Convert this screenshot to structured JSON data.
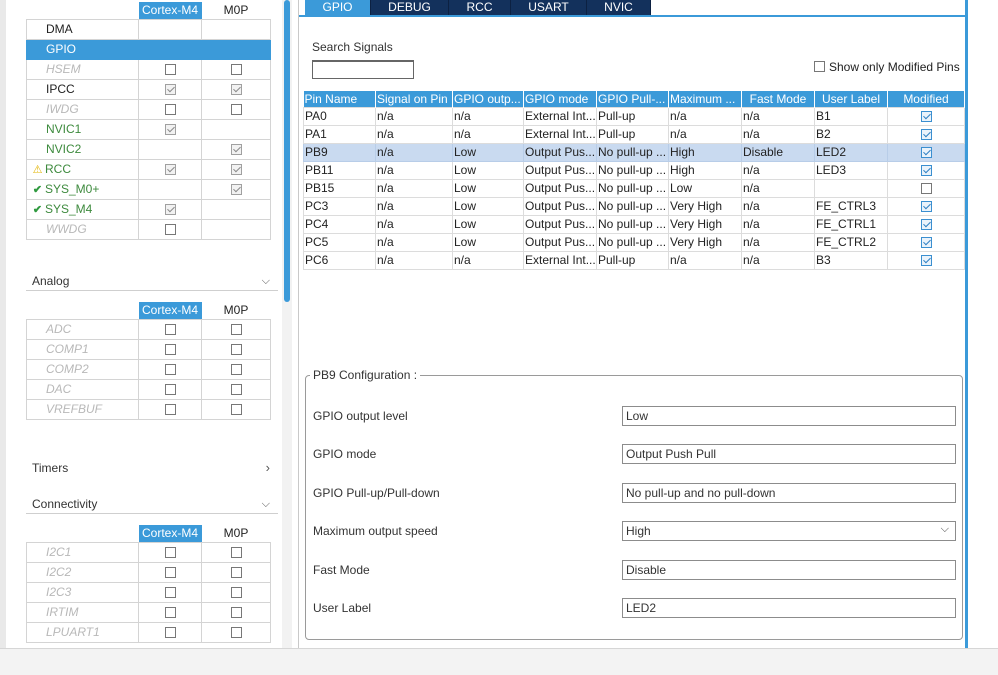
{
  "left": {
    "top_header": {
      "col1": "Cortex-M4",
      "col2": "M0P"
    },
    "top_items": [
      {
        "name": "DMA",
        "status": "none",
        "style": "normal",
        "m4": "",
        "m0p": ""
      },
      {
        "name": "GPIO",
        "status": "none",
        "style": "selected",
        "m4": "",
        "m0p": ""
      },
      {
        "name": "HSEM",
        "status": "none",
        "style": "disabled",
        "m4": "box",
        "m0p": "box"
      },
      {
        "name": "IPCC",
        "status": "none",
        "style": "normal",
        "m4": "checked",
        "m0p": "checked"
      },
      {
        "name": "IWDG",
        "status": "none",
        "style": "disabled",
        "m4": "box",
        "m0p": "box"
      },
      {
        "name": "NVIC1",
        "status": "none",
        "style": "ok",
        "m4": "checked",
        "m0p": ""
      },
      {
        "name": "NVIC2",
        "status": "none",
        "style": "ok",
        "m4": "",
        "m0p": "checked"
      },
      {
        "name": "RCC",
        "status": "warn",
        "style": "ok",
        "m4": "checked",
        "m0p": "checked"
      },
      {
        "name": "SYS_M0+",
        "status": "check",
        "style": "ok",
        "m4": "",
        "m0p": "checked"
      },
      {
        "name": "SYS_M4",
        "status": "check",
        "style": "ok",
        "m4": "checked",
        "m0p": ""
      },
      {
        "name": "WWDG",
        "status": "none",
        "style": "disabled",
        "m4": "box",
        "m0p": ""
      }
    ],
    "analog": {
      "title": "Analog",
      "header": {
        "col1": "Cortex-M4",
        "col2": "M0P"
      },
      "items": [
        {
          "name": "ADC",
          "m4": "box",
          "m0p": "box"
        },
        {
          "name": "COMP1",
          "m4": "box",
          "m0p": "box"
        },
        {
          "name": "COMP2",
          "m4": "box",
          "m0p": "box"
        },
        {
          "name": "DAC",
          "m4": "box",
          "m0p": "box"
        },
        {
          "name": "VREFBUF",
          "m4": "box",
          "m0p": "box"
        }
      ]
    },
    "timers": {
      "title": "Timers"
    },
    "connectivity": {
      "title": "Connectivity",
      "header": {
        "col1": "Cortex-M4",
        "col2": "M0P"
      },
      "items": [
        {
          "name": "I2C1",
          "m4": "box",
          "m0p": "box"
        },
        {
          "name": "I2C2",
          "m4": "box",
          "m0p": "box"
        },
        {
          "name": "I2C3",
          "m4": "box",
          "m0p": "box"
        },
        {
          "name": "IRTIM",
          "m4": "box",
          "m0p": "box"
        },
        {
          "name": "LPUART1",
          "m4": "box",
          "m0p": "box"
        }
      ]
    }
  },
  "tabs": [
    "GPIO",
    "DEBUG",
    "RCC",
    "USART",
    "NVIC"
  ],
  "active_tab": "GPIO",
  "search": {
    "label": "Search Signals",
    "value": ""
  },
  "show_modified_label": "Show only Modified Pins",
  "gpio_table": {
    "columns": [
      "Pin Name",
      "Signal on Pin",
      "GPIO outp...",
      "GPIO mode",
      "GPIO Pull-...",
      "Maximum ...",
      "Fast Mode",
      "User Label",
      "Modified"
    ],
    "rows": [
      {
        "pin": "PA0",
        "signal": "n/a",
        "output": "n/a",
        "mode": "External Int...",
        "pull": "Pull-up",
        "speed": "n/a",
        "fast": "n/a",
        "label": "B1",
        "modified": true
      },
      {
        "pin": "PA1",
        "signal": "n/a",
        "output": "n/a",
        "mode": "External Int...",
        "pull": "Pull-up",
        "speed": "n/a",
        "fast": "n/a",
        "label": "B2",
        "modified": true
      },
      {
        "pin": "PB9",
        "signal": "n/a",
        "output": "Low",
        "mode": "Output Pus...",
        "pull": "No pull-up ...",
        "speed": "High",
        "fast": "Disable",
        "label": "LED2",
        "modified": true,
        "selected": true
      },
      {
        "pin": "PB11",
        "signal": "n/a",
        "output": "Low",
        "mode": "Output Pus...",
        "pull": "No pull-up ...",
        "speed": "High",
        "fast": "n/a",
        "label": "LED3",
        "modified": true
      },
      {
        "pin": "PB15",
        "signal": "n/a",
        "output": "Low",
        "mode": "Output Pus...",
        "pull": "No pull-up ...",
        "speed": "Low",
        "fast": "n/a",
        "label": "",
        "modified": false
      },
      {
        "pin": "PC3",
        "signal": "n/a",
        "output": "Low",
        "mode": "Output Pus...",
        "pull": "No pull-up ...",
        "speed": "Very High",
        "fast": "n/a",
        "label": "FE_CTRL3",
        "modified": true
      },
      {
        "pin": "PC4",
        "signal": "n/a",
        "output": "Low",
        "mode": "Output Pus...",
        "pull": "No pull-up ...",
        "speed": "Very High",
        "fast": "n/a",
        "label": "FE_CTRL1",
        "modified": true
      },
      {
        "pin": "PC5",
        "signal": "n/a",
        "output": "Low",
        "mode": "Output Pus...",
        "pull": "No pull-up ...",
        "speed": "Very High",
        "fast": "n/a",
        "label": "FE_CTRL2",
        "modified": true
      },
      {
        "pin": "PC6",
        "signal": "n/a",
        "output": "n/a",
        "mode": "External Int...",
        "pull": "Pull-up",
        "speed": "n/a",
        "fast": "n/a",
        "label": "B3",
        "modified": true
      }
    ]
  },
  "config": {
    "title": "PB9 Configuration :",
    "fields": [
      {
        "label": "GPIO output level",
        "value": "Low",
        "type": "text"
      },
      {
        "label": "GPIO mode",
        "value": "Output Push Pull",
        "type": "text"
      },
      {
        "label": "GPIO Pull-up/Pull-down",
        "value": "No pull-up and no pull-down",
        "type": "text"
      },
      {
        "label": "Maximum output speed",
        "value": "High",
        "type": "dropdown"
      },
      {
        "label": "Fast Mode",
        "value": "Disable",
        "type": "text"
      },
      {
        "label": "User Label",
        "value": "LED2",
        "type": "text"
      }
    ]
  },
  "colors": {
    "accent": "#3b9ad9",
    "tab_inactive": "#13315c",
    "selected_row": "#c9daf0",
    "ok_text": "#3d8a3d"
  }
}
